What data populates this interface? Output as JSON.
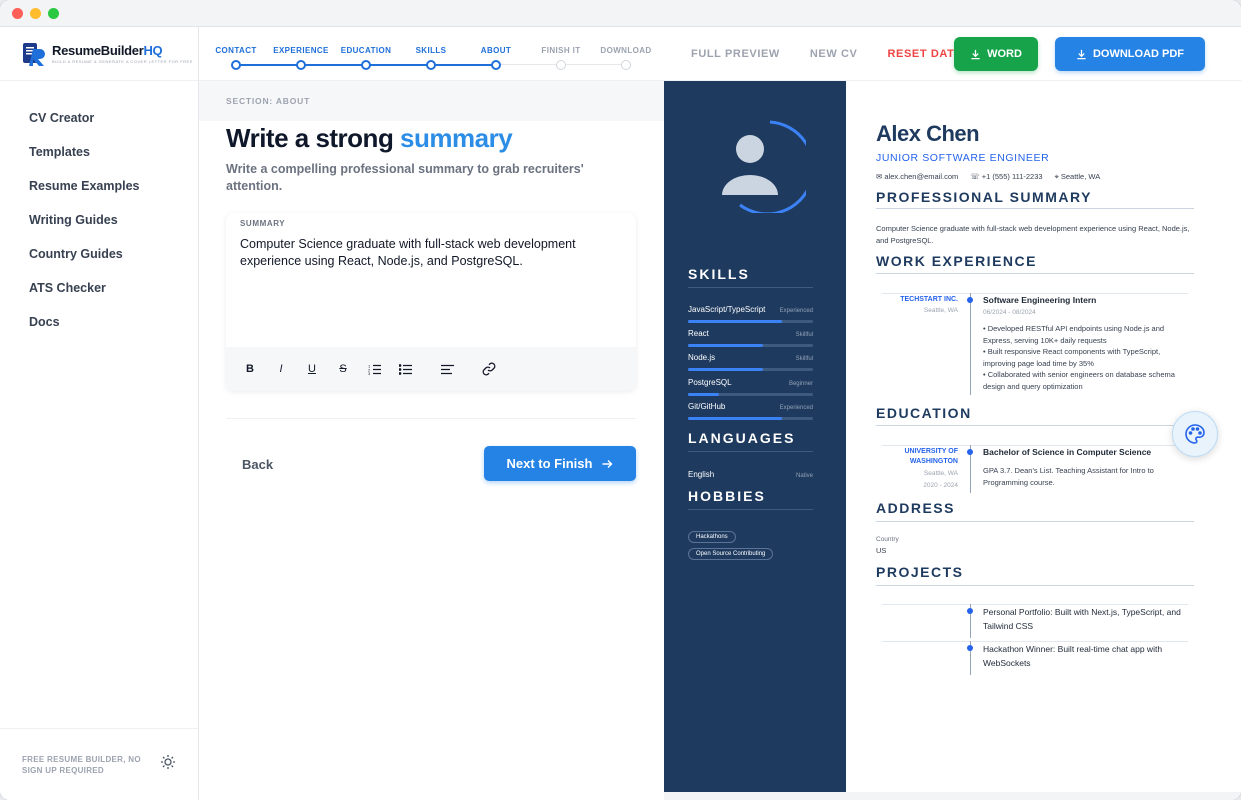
{
  "brand": {
    "name_main": "ResumeBuilder",
    "name_accent": "HQ",
    "tagline": "BUILD A RESUME & GENERATE A COVER LETTER FOR FREE"
  },
  "sidebar": {
    "items": [
      {
        "label": "CV Creator"
      },
      {
        "label": "Templates"
      },
      {
        "label": "Resume Examples"
      },
      {
        "label": "Writing Guides"
      },
      {
        "label": "Country Guides"
      },
      {
        "label": "ATS Checker"
      },
      {
        "label": "Docs"
      }
    ],
    "footer": "FREE RESUME BUILDER, NO SIGN UP REQUIRED"
  },
  "steps": [
    {
      "label": "CONTACT",
      "done": true
    },
    {
      "label": "EXPERIENCE",
      "done": true
    },
    {
      "label": "EDUCATION",
      "done": true
    },
    {
      "label": "SKILLS",
      "done": true
    },
    {
      "label": "ABOUT",
      "done": true
    },
    {
      "label": "FINISH IT",
      "done": false
    },
    {
      "label": "DOWNLOAD",
      "done": false
    }
  ],
  "header": {
    "full_preview": "FULL PREVIEW",
    "new_cv": "NEW CV",
    "reset": "RESET DATA",
    "word": "WORD",
    "pdf": "DOWNLOAD PDF"
  },
  "editor": {
    "section": "SECTION: ABOUT",
    "heading_main": "Write a strong ",
    "heading_accent": "summary",
    "subheading": "Write a compelling professional summary to grab recruiters' attention.",
    "field_label": "SUMMARY",
    "field_value": "Computer Science graduate with full-stack web development experience using React, Node.js, and PostgreSQL.",
    "toolbar": [
      "B",
      "I",
      "U",
      "S"
    ],
    "back": "Back",
    "next": "Next to Finish"
  },
  "cv": {
    "name": "Alex Chen",
    "title": "JUNIOR SOFTWARE ENGINEER",
    "email": "alex.chen@email.com",
    "phone": "+1 (555) 111-2233",
    "location": "Seattle, WA",
    "skills_heading": "SKILLS",
    "skills": [
      {
        "name": "JavaScript/TypeScript",
        "level": "Experienced",
        "pct": 0.75
      },
      {
        "name": "React",
        "level": "Skillful",
        "pct": 0.6
      },
      {
        "name": "Node.js",
        "level": "Skillful",
        "pct": 0.6
      },
      {
        "name": "PostgreSQL",
        "level": "Beginner",
        "pct": 0.25
      },
      {
        "name": "Git/GitHub",
        "level": "Experienced",
        "pct": 0.75
      }
    ],
    "languages_heading": "LANGUAGES",
    "languages": [
      {
        "name": "English",
        "level": "Native"
      }
    ],
    "hobbies_heading": "HOBBIES",
    "hobbies": [
      "Hackathons",
      "Open Source Contributing"
    ],
    "summary_heading": "PROFESSIONAL SUMMARY",
    "summary": "Computer Science graduate with full-stack web development experience using React, Node.js, and PostgreSQL.",
    "work_heading": "WORK EXPERIENCE",
    "work": {
      "org": "TECHSTART INC.",
      "loc": "Seattle, WA",
      "role": "Software Engineering Intern",
      "date": "06/2024 - 08/2024",
      "b1": "• Developed RESTful API endpoints using Node.js and Express, serving 10K+ daily requests",
      "b2": "• Built responsive React components with TypeScript, improving page load time by 35%",
      "b3": "• Collaborated with senior engineers on database schema design and query optimization"
    },
    "education_heading": "EDUCATION",
    "education": {
      "org": "UNIVERSITY OF WASHINGTON",
      "loc": "Seattle, WA",
      "dates": "2020 - 2024",
      "degree": "Bachelor of Science in Computer Science",
      "details": "GPA 3.7. Dean's List. Teaching Assistant for Intro to Programming course."
    },
    "address_heading": "ADDRESS",
    "country_label": "Country",
    "country": "US",
    "projects_heading": "PROJECTS",
    "projects": [
      "Personal Portfolio: Built with Next.js, TypeScript, and Tailwind CSS",
      "Hackathon Winner: Built real-time chat app with WebSockets"
    ]
  },
  "colors": {
    "accent": "#1e6fd9",
    "word": "#16a34a",
    "pdf": "#2583e6",
    "cv_sidebar": "#1e3a5f",
    "reset": "#ef4444"
  }
}
